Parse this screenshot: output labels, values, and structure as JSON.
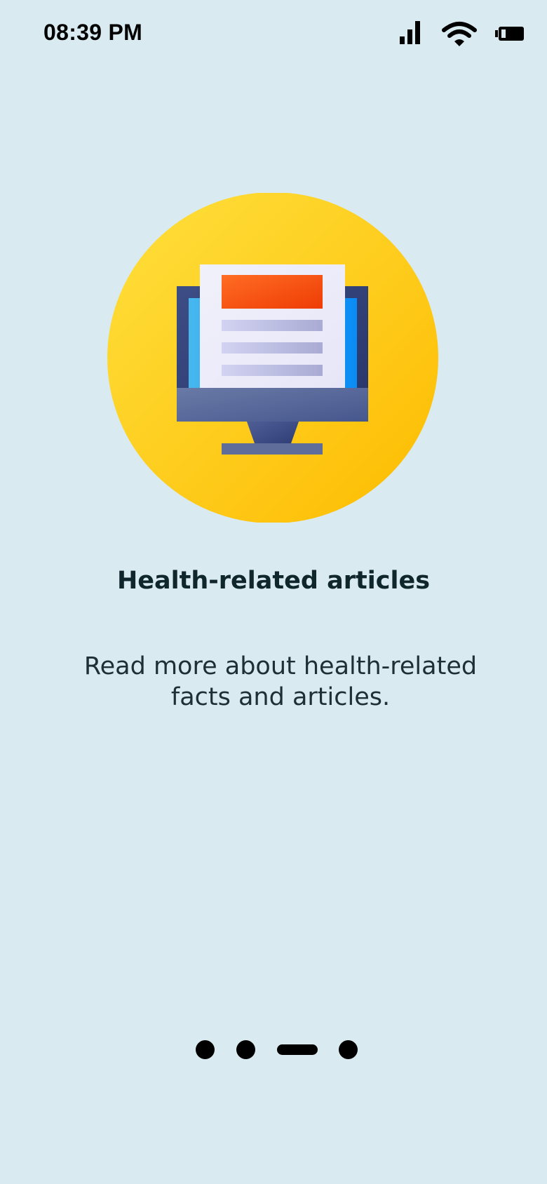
{
  "status_bar": {
    "time": "08:39 PM",
    "icons": [
      "signal-icon",
      "wifi-icon",
      "battery-icon"
    ]
  },
  "onboarding": {
    "illustration": "monitor-article-icon",
    "title": "Health-related articles",
    "description": "Read more about health-related facts and articles."
  },
  "pagination": {
    "total_pages": 4,
    "active_index": 2
  },
  "colors": {
    "background": "#d9eaf0",
    "accent_circle": "#fdc40b",
    "title_text": "#0f262c"
  }
}
